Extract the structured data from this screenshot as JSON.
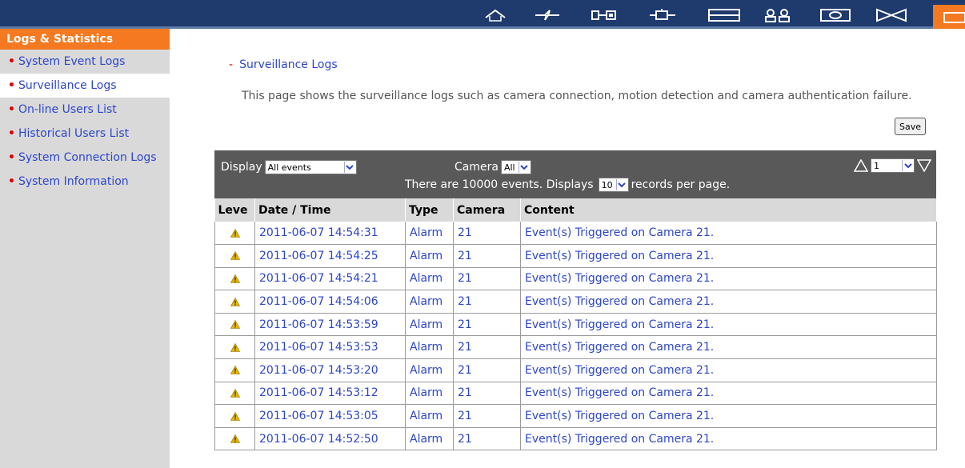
{
  "topbar": {
    "icons": [
      "home-icon",
      "quick-config-icon",
      "system-settings-icon",
      "network-icon",
      "disk-icon",
      "users-icon",
      "applications-icon",
      "backup-icon",
      "logs-icon"
    ],
    "accent": "#f47920",
    "background": "#1f3a6d"
  },
  "sidebar": {
    "header": "Logs & Statistics",
    "items": [
      {
        "label": "System Event Logs"
      },
      {
        "label": "Surveillance Logs"
      },
      {
        "label": "On-line Users List"
      },
      {
        "label": "Historical Users List"
      },
      {
        "label": "System Connection Logs"
      },
      {
        "label": "System Information"
      }
    ]
  },
  "main": {
    "title": "Surveillance Logs",
    "description": "This page shows the surveillance logs such as camera connection, motion detection and camera authentication failure.",
    "save_label": "Save"
  },
  "toolbar": {
    "display_label": "Display",
    "display_value": "All events",
    "camera_label": "Camera",
    "camera_value": "All",
    "summary_prefix": "There are 10000 events.  Displays",
    "per_page_value": "10",
    "summary_suffix": "records per page.",
    "page_value": "1"
  },
  "table": {
    "headers": [
      "Leve",
      "Date / Time",
      "Type",
      "Camera",
      "Content"
    ],
    "rows": [
      {
        "level": "warning-icon",
        "datetime": "2011-06-07 14:54:31",
        "type": "Alarm",
        "camera": "21",
        "content": "Event(s) Triggered on Camera 21."
      },
      {
        "level": "warning-icon",
        "datetime": "2011-06-07 14:54:25",
        "type": "Alarm",
        "camera": "21",
        "content": "Event(s) Triggered on Camera 21."
      },
      {
        "level": "warning-icon",
        "datetime": "2011-06-07 14:54:21",
        "type": "Alarm",
        "camera": "21",
        "content": "Event(s) Triggered on Camera 21."
      },
      {
        "level": "warning-icon",
        "datetime": "2011-06-07 14:54:06",
        "type": "Alarm",
        "camera": "21",
        "content": "Event(s) Triggered on Camera 21."
      },
      {
        "level": "warning-icon",
        "datetime": "2011-06-07 14:53:59",
        "type": "Alarm",
        "camera": "21",
        "content": "Event(s) Triggered on Camera 21."
      },
      {
        "level": "warning-icon",
        "datetime": "2011-06-07 14:53:53",
        "type": "Alarm",
        "camera": "21",
        "content": "Event(s) Triggered on Camera 21."
      },
      {
        "level": "warning-icon",
        "datetime": "2011-06-07 14:53:20",
        "type": "Alarm",
        "camera": "21",
        "content": "Event(s) Triggered on Camera 21."
      },
      {
        "level": "warning-icon",
        "datetime": "2011-06-07 14:53:12",
        "type": "Alarm",
        "camera": "21",
        "content": "Event(s) Triggered on Camera 21."
      },
      {
        "level": "warning-icon",
        "datetime": "2011-06-07 14:53:05",
        "type": "Alarm",
        "camera": "21",
        "content": "Event(s) Triggered on Camera 21."
      },
      {
        "level": "warning-icon",
        "datetime": "2011-06-07 14:52:50",
        "type": "Alarm",
        "camera": "21",
        "content": "Event(s) Triggered on Camera 21."
      }
    ]
  }
}
